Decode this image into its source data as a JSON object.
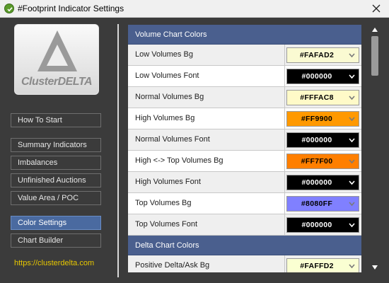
{
  "window": {
    "title": "#Footprint Indicator Settings"
  },
  "logo": {
    "text": "ClusterDELTA"
  },
  "nav": {
    "items": [
      {
        "label": "How To Start"
      },
      {
        "label": "Summary Indicators"
      },
      {
        "label": "Imbalances"
      },
      {
        "label": "Unfinished Auctions"
      },
      {
        "label": "Value Area / POC"
      },
      {
        "label": "Color Settings",
        "active": true
      },
      {
        "label": "Chart Builder"
      }
    ],
    "site_link": "https://clusterdelta.com"
  },
  "volume_section": {
    "title": "Volume Chart Colors",
    "rows": [
      {
        "label": "Low Volumes Bg",
        "value": "#FAFAD2",
        "color": "#FAFAD2",
        "text_color": "#000000"
      },
      {
        "label": "Low Volumes Font",
        "value": "#000000",
        "color": "#000000",
        "text_color": "#FFFFFF"
      },
      {
        "label": "Normal Volumes Bg",
        "value": "#FFFAC8",
        "color": "#FFFAC8",
        "text_color": "#000000"
      },
      {
        "label": "High Volumes Bg",
        "value": "#FF9900",
        "color": "#FF9900",
        "text_color": "#000000"
      },
      {
        "label": "Normal Volumes Font",
        "value": "#000000",
        "color": "#000000",
        "text_color": "#FFFFFF"
      },
      {
        "label": "High <-> Top Volumes Bg",
        "value": "#FF7F00",
        "color": "#FF7F00",
        "text_color": "#000000"
      },
      {
        "label": "High Volumes Font",
        "value": "#000000",
        "color": "#000000",
        "text_color": "#FFFFFF"
      },
      {
        "label": "Top Volumes Bg",
        "value": "#8080FF",
        "color": "#8080FF",
        "text_color": "#000000"
      },
      {
        "label": "Top Volumes Font",
        "value": "#000000",
        "color": "#000000",
        "text_color": "#FFFFFF"
      }
    ]
  },
  "delta_section": {
    "title": "Delta Chart Colors",
    "rows": [
      {
        "label": "Positive Delta/Ask Bg",
        "value": "#FAFFD2",
        "color": "#FAFFD2",
        "text_color": "#000000"
      }
    ]
  },
  "icons": {
    "app": "check-circle-icon",
    "close": "close-icon",
    "dropdown": "chevron-down-icon",
    "scroll_up": "arrow-up-icon",
    "scroll_down": "arrow-down-icon"
  },
  "colors": {
    "accent": "#4A6AA0",
    "section_header": "#4A5F8E",
    "link": "#E8C800",
    "background": "#3B3B3B"
  }
}
